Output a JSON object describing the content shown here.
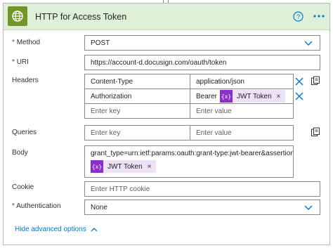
{
  "header": {
    "title": "HTTP for Access Token",
    "icons": [
      "globe-icon",
      "help-icon",
      "more-options-icon"
    ],
    "accent_color": "#709727",
    "background_color": "#dff0d8"
  },
  "fields": {
    "method": {
      "label": "Method",
      "required_mark": "*",
      "value": "POST"
    },
    "uri": {
      "label": "URI",
      "required_mark": "*",
      "value": "https://account-d.docusign.com/oauth/token"
    },
    "headers": {
      "label": "Headers",
      "rows": [
        {
          "key": "Content-Type",
          "value": "application/json"
        },
        {
          "key": "Authorization",
          "value_prefix": "Bearer",
          "token": "JWT Token"
        }
      ],
      "key_placeholder": "Enter key",
      "value_placeholder": "Enter value"
    },
    "queries": {
      "label": "Queries",
      "key_placeholder": "Enter key",
      "value_placeholder": "Enter value"
    },
    "body": {
      "label": "Body",
      "text": "grant_type=urn:ietf:params:oauth:grant-type:jwt-bearer&assertion=",
      "token": "JWT Token"
    },
    "cookie": {
      "label": "Cookie",
      "placeholder": "Enter HTTP cookie"
    },
    "authentication": {
      "label": "Authentication",
      "required_mark": "*",
      "value": "None"
    }
  },
  "token_icon_text": "{x}",
  "token_remove": "×",
  "advanced_toggle": "Hide advanced options",
  "colors": {
    "token_icon": "#8b2fc9",
    "token_bg": "#ece1f5",
    "link": "#0078d4",
    "delete_icon": "#0078d4"
  }
}
